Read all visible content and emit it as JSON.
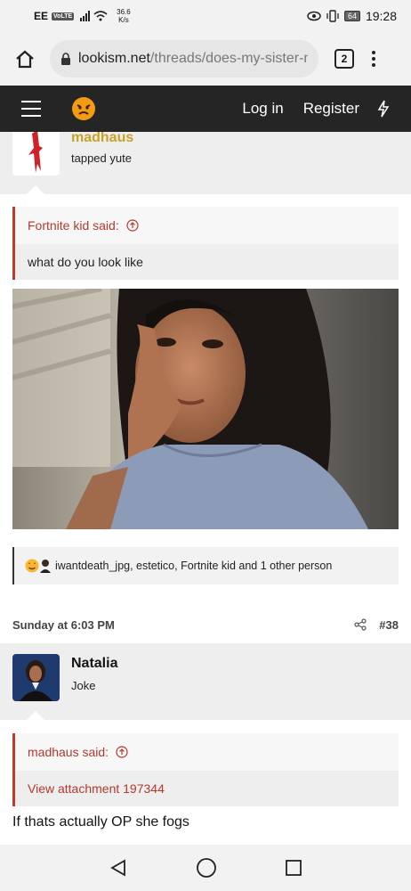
{
  "status_bar": {
    "carrier": "EE",
    "volte": "VoLTE",
    "speed_value": "36.6",
    "speed_unit": "K/s",
    "battery": "64",
    "time": "19:28"
  },
  "browser": {
    "url_domain": "lookism.net",
    "url_path": "/threads/does-my-sister-mo",
    "tab_count": "2"
  },
  "site_header": {
    "login": "Log in",
    "register": "Register"
  },
  "post1": {
    "username": "madhaus",
    "user_title": "tapped yute",
    "quote_author": "Fortnite kid said:",
    "quote_text": "what do you look like",
    "reactions_text": "iwantdeath_jpg, estetico, Fortnite kid and 1 other person"
  },
  "post2": {
    "date": "Sunday at 6:03 PM",
    "number": "#38",
    "username": "Natalia",
    "user_title": "Joke",
    "quote_author": "madhaus said:",
    "quote_link": "View attachment 197344",
    "body": "If thats actually OP she fogs"
  },
  "colors": {
    "header_bg": "#252525",
    "quote_accent": "#c0392b",
    "username_gold": "#c9a227"
  }
}
